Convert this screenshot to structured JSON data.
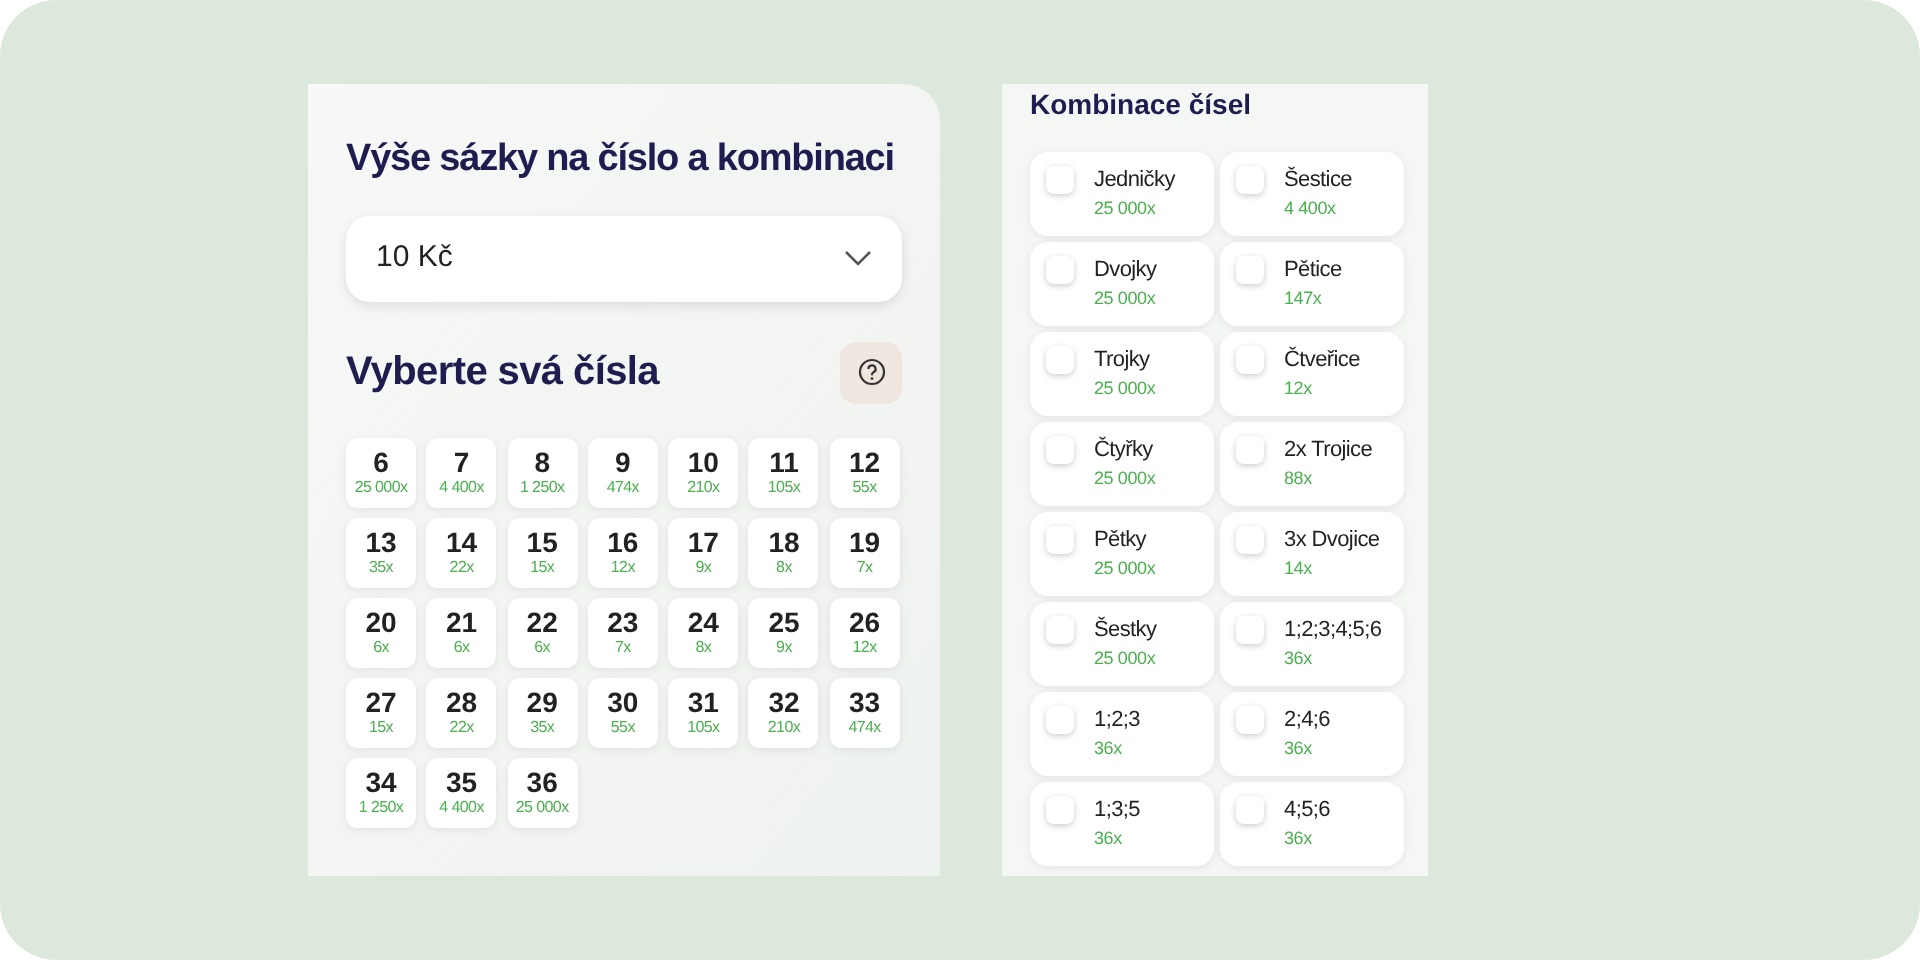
{
  "bet_panel": {
    "title": "Výše sázky na číslo a kombinaci",
    "amount_select": {
      "value": "10 Kč"
    },
    "numbers_title": "Vyberte svá čísla",
    "numbers": [
      {
        "number": "6",
        "odds": "25 000x",
        "selected": false
      },
      {
        "number": "7",
        "odds": "4 400x",
        "selected": false
      },
      {
        "number": "8",
        "odds": "1 250x",
        "selected": false
      },
      {
        "number": "9",
        "odds": "474x",
        "selected": false
      },
      {
        "number": "10",
        "odds": "210x",
        "selected": false
      },
      {
        "number": "11",
        "odds": "105x",
        "selected": false
      },
      {
        "number": "12",
        "odds": "55x",
        "selected": false
      },
      {
        "number": "13",
        "odds": "35x",
        "selected": false
      },
      {
        "number": "14",
        "odds": "22x",
        "selected": false
      },
      {
        "number": "15",
        "odds": "15x",
        "selected": false
      },
      {
        "number": "16",
        "odds": "12x",
        "selected": false
      },
      {
        "number": "17",
        "odds": "9x",
        "selected": false
      },
      {
        "number": "18",
        "odds": "8x",
        "selected": false
      },
      {
        "number": "19",
        "odds": "7x",
        "selected": false
      },
      {
        "number": "20",
        "odds": "6x",
        "selected": false
      },
      {
        "number": "21",
        "odds": "6x",
        "selected": false
      },
      {
        "number": "22",
        "odds": "6x",
        "selected": false
      },
      {
        "number": "23",
        "odds": "7x",
        "selected": false
      },
      {
        "number": "24",
        "odds": "8x",
        "selected": false
      },
      {
        "number": "25",
        "odds": "9x",
        "selected": false
      },
      {
        "number": "26",
        "odds": "12x",
        "selected": false
      },
      {
        "number": "27",
        "odds": "15x",
        "selected": false
      },
      {
        "number": "28",
        "odds": "22x",
        "selected": false
      },
      {
        "number": "29",
        "odds": "35x",
        "selected": false
      },
      {
        "number": "30",
        "odds": "55x",
        "selected": false
      },
      {
        "number": "31",
        "odds": "105x",
        "selected": false
      },
      {
        "number": "32",
        "odds": "210x",
        "selected": false
      },
      {
        "number": "33",
        "odds": "474x",
        "selected": false
      },
      {
        "number": "34",
        "odds": "1 250x",
        "selected": false
      },
      {
        "number": "35",
        "odds": "4 400x",
        "selected": false
      },
      {
        "number": "36",
        "odds": "25 000x",
        "selected": false
      }
    ]
  },
  "combinations_panel": {
    "title": "Kombinace čísel",
    "options": [
      {
        "label": "Jedničky",
        "odds": "25 000x",
        "checked": false
      },
      {
        "label": "Šestice",
        "odds": "4 400x",
        "checked": false
      },
      {
        "label": "Dvojky",
        "odds": "25 000x",
        "checked": false
      },
      {
        "label": "Pětice",
        "odds": "147x",
        "checked": false
      },
      {
        "label": "Trojky",
        "odds": "25 000x",
        "checked": false
      },
      {
        "label": "Čtveřice",
        "odds": "12x",
        "checked": false
      },
      {
        "label": "Čtyřky",
        "odds": "25 000x",
        "checked": false
      },
      {
        "label": "2x Trojice",
        "odds": "88x",
        "checked": false
      },
      {
        "label": "Pětky",
        "odds": "25 000x",
        "checked": false
      },
      {
        "label": "3x Dvojice",
        "odds": "14x",
        "checked": false
      },
      {
        "label": "Šestky",
        "odds": "25 000x",
        "checked": false
      },
      {
        "label": "1;2;3;4;5;6",
        "odds": "36x",
        "checked": false
      },
      {
        "label": "1;2;3",
        "odds": "36x",
        "checked": false
      },
      {
        "label": "2;4;6",
        "odds": "36x",
        "checked": false
      },
      {
        "label": "1;3;5",
        "odds": "36x",
        "checked": false
      },
      {
        "label": "4;5;6",
        "odds": "36x",
        "checked": false
      }
    ]
  }
}
